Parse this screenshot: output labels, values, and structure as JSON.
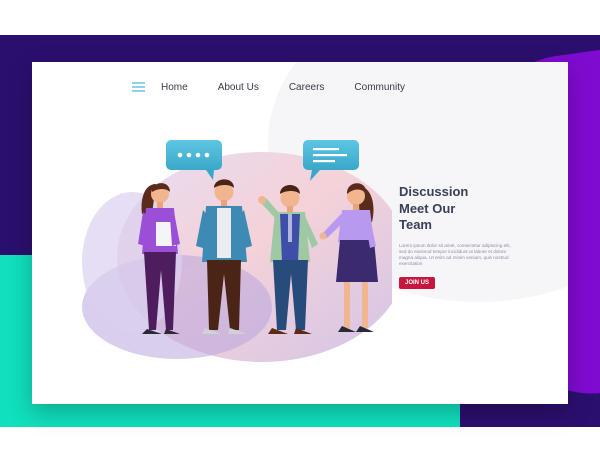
{
  "nav": {
    "menu_icon": "hamburger-menu-icon",
    "links": [
      "Home",
      "About Us",
      "Careers",
      "Community"
    ]
  },
  "hero": {
    "title_lines": [
      "Discussion",
      "Meet Our",
      "Team"
    ],
    "body": "Lorem ipsum dolor sit amet, consectetur adipiscing elit, sed do eiusmod tempor incididunt ut labore et dolore magna aliqua. Ut enim ad minim veniam, quis nostrud exercitation",
    "cta_label": "JOIN US"
  },
  "illustration": {
    "chat_bubble_left": "typing-dots-icon",
    "chat_bubble_right": "message-lines-icon"
  },
  "colors": {
    "background_dark": "#2b0f6e",
    "accent_purple": "#7f0bd0",
    "accent_teal": "#10e0bd",
    "cta": "#c8173d",
    "title_text": "#3b3f58"
  }
}
